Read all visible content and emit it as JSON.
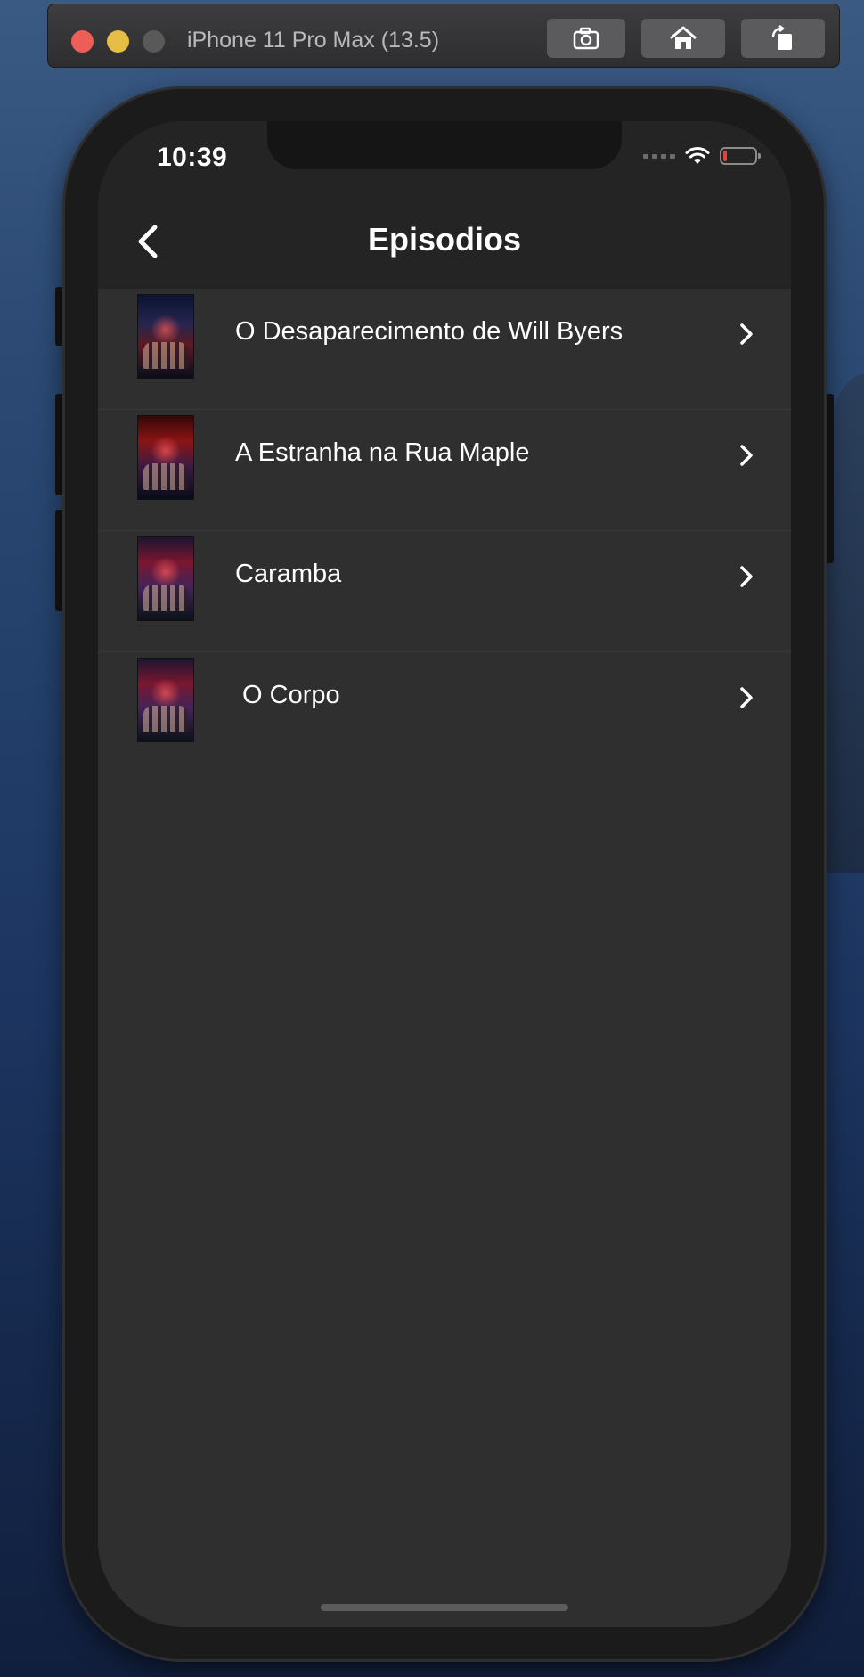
{
  "simulator": {
    "title": "iPhone 11 Pro Max (13.5)",
    "buttons": [
      {
        "icon": "screenshot-icon"
      },
      {
        "icon": "home-icon"
      },
      {
        "icon": "rotate-icon"
      }
    ]
  },
  "status_bar": {
    "time": "10:39",
    "battery_color": "#e0443b"
  },
  "nav": {
    "title": "Episodios",
    "back_icon": "chevron-left-icon"
  },
  "episodes": [
    {
      "title": "O Desaparecimento de Will Byers",
      "thumbnail": "poster-icon"
    },
    {
      "title": "A Estranha na Rua Maple",
      "thumbnail": "poster-icon"
    },
    {
      "title": "Caramba",
      "thumbnail": "poster-icon"
    },
    {
      "title": " O Corpo",
      "thumbnail": "poster-icon"
    }
  ],
  "colors": {
    "screen_background": "#2f2f2f",
    "header_background": "#242424",
    "text": "#ffffff"
  }
}
